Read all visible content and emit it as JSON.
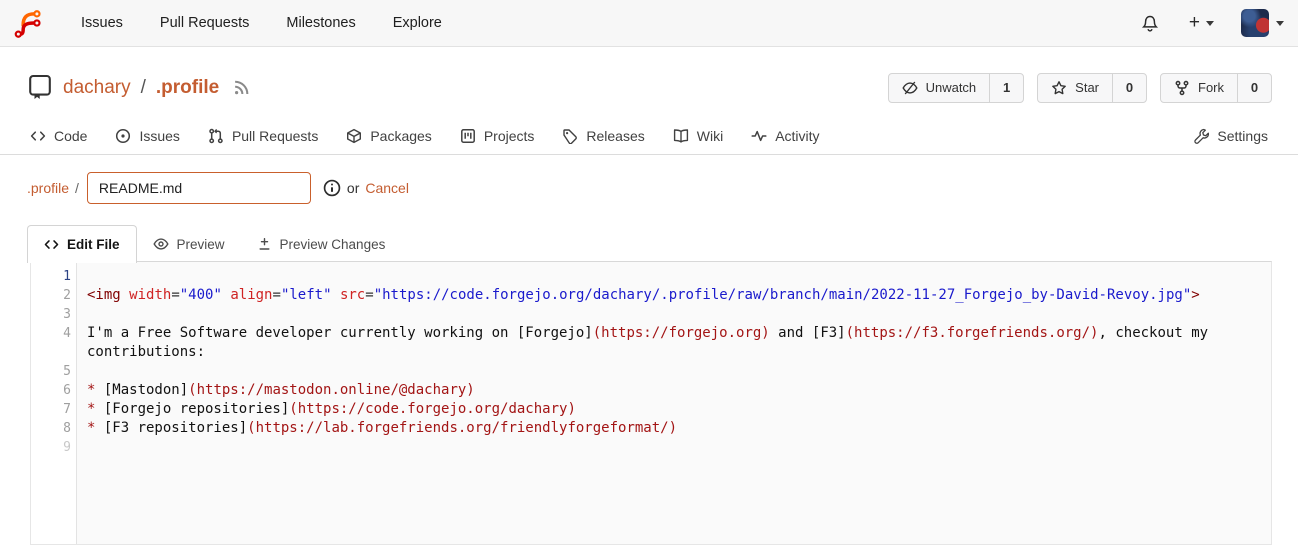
{
  "navbar": {
    "items": [
      {
        "label": "Issues"
      },
      {
        "label": "Pull Requests"
      },
      {
        "label": "Milestones"
      },
      {
        "label": "Explore"
      }
    ],
    "plus": "+"
  },
  "repo": {
    "owner": "dachary",
    "separator": "/",
    "name": ".profile",
    "actions": {
      "watch": {
        "label": "Unwatch",
        "count": "1"
      },
      "star": {
        "label": "Star",
        "count": "0"
      },
      "fork": {
        "label": "Fork",
        "count": "0"
      }
    }
  },
  "repo_tabs": {
    "items": [
      {
        "label": "Code"
      },
      {
        "label": "Issues"
      },
      {
        "label": "Pull Requests"
      },
      {
        "label": "Packages"
      },
      {
        "label": "Projects"
      },
      {
        "label": "Releases"
      },
      {
        "label": "Wiki"
      },
      {
        "label": "Activity"
      }
    ],
    "settings": "Settings"
  },
  "breadcrumb": {
    "dir": ".profile",
    "separator": "/",
    "filename": "README.md",
    "or_text": "or",
    "cancel": "Cancel"
  },
  "editor_tabs": {
    "edit": "Edit File",
    "preview": "Preview",
    "preview_changes": "Preview Changes"
  },
  "editor": {
    "rows": [
      {
        "num": "1",
        "style": "active",
        "segs": []
      },
      {
        "num": "2",
        "style": "",
        "segs": [
          {
            "c": "tag",
            "t": "<img "
          },
          {
            "c": "attr",
            "t": "width"
          },
          {
            "c": "delim",
            "t": "="
          },
          {
            "c": "str",
            "t": "\"400\""
          },
          {
            "c": "plain",
            "t": " "
          },
          {
            "c": "attr",
            "t": "align"
          },
          {
            "c": "delim",
            "t": "="
          },
          {
            "c": "str",
            "t": "\"left\""
          },
          {
            "c": "plain",
            "t": " "
          },
          {
            "c": "attr",
            "t": "src"
          },
          {
            "c": "delim",
            "t": "="
          },
          {
            "c": "str",
            "t": "\"https://code.forgejo.org/dachary/.profile/raw/branch/main/2022-11-27_Forgejo_by-David-Revoy.jpg\""
          },
          {
            "c": "tag",
            "t": ">"
          }
        ]
      },
      {
        "num": "3",
        "style": "",
        "segs": []
      },
      {
        "num": "4",
        "style": "",
        "segs": [
          {
            "c": "plain",
            "t": "I'm a Free Software developer currently working on [Forgejo]"
          },
          {
            "c": "url",
            "t": "(https://forgejo.org)"
          },
          {
            "c": "plain",
            "t": " and [F3]"
          },
          {
            "c": "url",
            "t": "(https://f3.forgefriends.org/)"
          },
          {
            "c": "plain",
            "t": ", checkout my"
          }
        ]
      },
      {
        "num": "",
        "style": "",
        "segs": [
          {
            "c": "plain",
            "t": "contributions:"
          }
        ]
      },
      {
        "num": "5",
        "style": "",
        "segs": []
      },
      {
        "num": "6",
        "style": "",
        "segs": [
          {
            "c": "list",
            "t": "* "
          },
          {
            "c": "plain",
            "t": "[Mastodon]"
          },
          {
            "c": "url",
            "t": "(https://mastodon.online/@dachary)"
          }
        ]
      },
      {
        "num": "7",
        "style": "",
        "segs": [
          {
            "c": "list",
            "t": "* "
          },
          {
            "c": "plain",
            "t": "[Forgejo repositories]"
          },
          {
            "c": "url",
            "t": "(https://code.forgejo.org/dachary)"
          }
        ]
      },
      {
        "num": "8",
        "style": "",
        "segs": [
          {
            "c": "list",
            "t": "* "
          },
          {
            "c": "plain",
            "t": "[F3 repositories]"
          },
          {
            "c": "url",
            "t": "(https://lab.forgefriends.org/friendlyforgeformat/)"
          }
        ]
      },
      {
        "num": "9",
        "style": "faint",
        "segs": []
      }
    ]
  },
  "colors": {
    "accent_orange": "#c45d31",
    "input_border": "#c9602c",
    "logo_orange": "#ff6600",
    "logo_red": "#d40000",
    "navbar_bg": "#f7f7f7",
    "editor_bg": "#fafafa",
    "syntax_tag": "#800000",
    "syntax_attribute": "#cf2323",
    "syntax_string": "#1a1acc",
    "syntax_md_url": "#a31515",
    "line_number": "#9f9f9f",
    "line_number_active": "#2c4384"
  }
}
